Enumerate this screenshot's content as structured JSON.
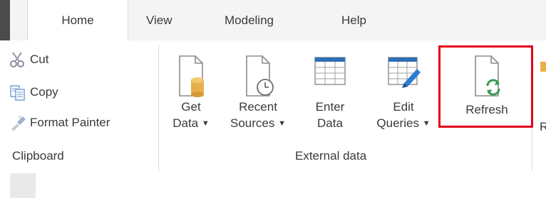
{
  "tabs": [
    "Home",
    "View",
    "Modeling",
    "Help"
  ],
  "clipboard": {
    "cut": "Cut",
    "copy": "Copy",
    "format_painter": "Format Painter",
    "group_label": "Clipboard"
  },
  "external_data": {
    "get_data": [
      "Get",
      "Data"
    ],
    "recent_sources": [
      "Recent",
      "Sources"
    ],
    "enter_data": [
      "Enter",
      "Data"
    ],
    "edit_queries": [
      "Edit",
      "Queries"
    ],
    "refresh": "Refresh",
    "group_label": "External data"
  },
  "partial_label": "R",
  "colors": {
    "highlight": "#e4001b",
    "cylinder": "#e8b04a",
    "refresh_green": "#3c9a52",
    "grid_header": "#2e6fb6",
    "pencil": "#2b7cd3"
  }
}
